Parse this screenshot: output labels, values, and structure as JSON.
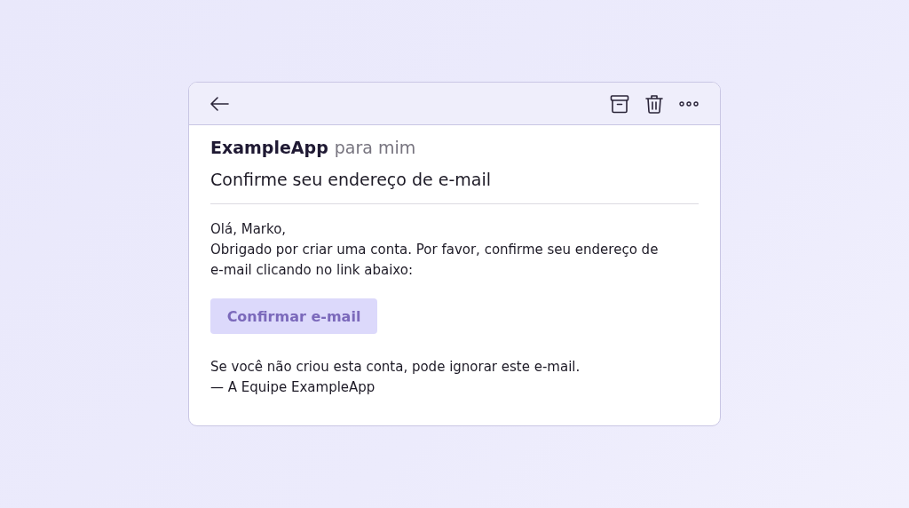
{
  "email": {
    "sender": "ExampleApp",
    "recipient": "para mim",
    "subject": "Confirme seu endereço de e-mail",
    "greeting": "Olá, Marko,",
    "message": "Obrigado por criar uma conta. Por favor, confirme seu endereço de e-mail clicando no link abaixo:",
    "button": "Confirmar e-mail",
    "note": "Se você não criou esta conta, pode ignorar este e-mail.",
    "signature": "— A Equipe ExampleApp"
  }
}
